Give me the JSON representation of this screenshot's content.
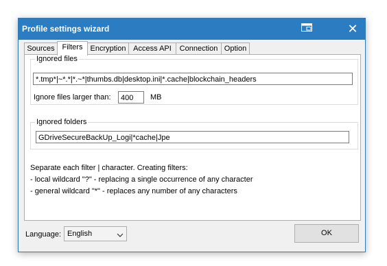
{
  "window": {
    "title": "Profile settings wizard",
    "title_icon": "restore-window-icon",
    "close_glyph": "✕"
  },
  "tabs": [
    {
      "label": "Sources"
    },
    {
      "label": "Filters",
      "active": true
    },
    {
      "label": "Encryption"
    },
    {
      "label": "Access API"
    },
    {
      "label": "Connection"
    },
    {
      "label": "Option"
    }
  ],
  "filters": {
    "ignored_files_legend": "Ignored files",
    "ignored_files_value": "*.tmp*|~*.*|*.~*|thumbs.db|desktop.ini|*.cache|blockchain_headers",
    "size_label": "Ignore files larger than:",
    "size_value": "400",
    "size_unit": "MB",
    "ignored_folders_legend": "Ignored folders",
    "ignored_folders_value": "GDriveSecureBackUp_Logi|*cache|Jpe",
    "info_lines": [
      "Separate each filter | character. Creating filters:",
      " - local wildcard \"?\" - replacing a single occurrence of any character",
      " - general wildcard \"*\" - replaces any number of any characters"
    ]
  },
  "footer": {
    "language_label": "Language:",
    "language_value": "English",
    "ok_label": "OK"
  },
  "colors": {
    "titlebar": "#2b7cc0",
    "window_bg": "#f0f0f0"
  }
}
